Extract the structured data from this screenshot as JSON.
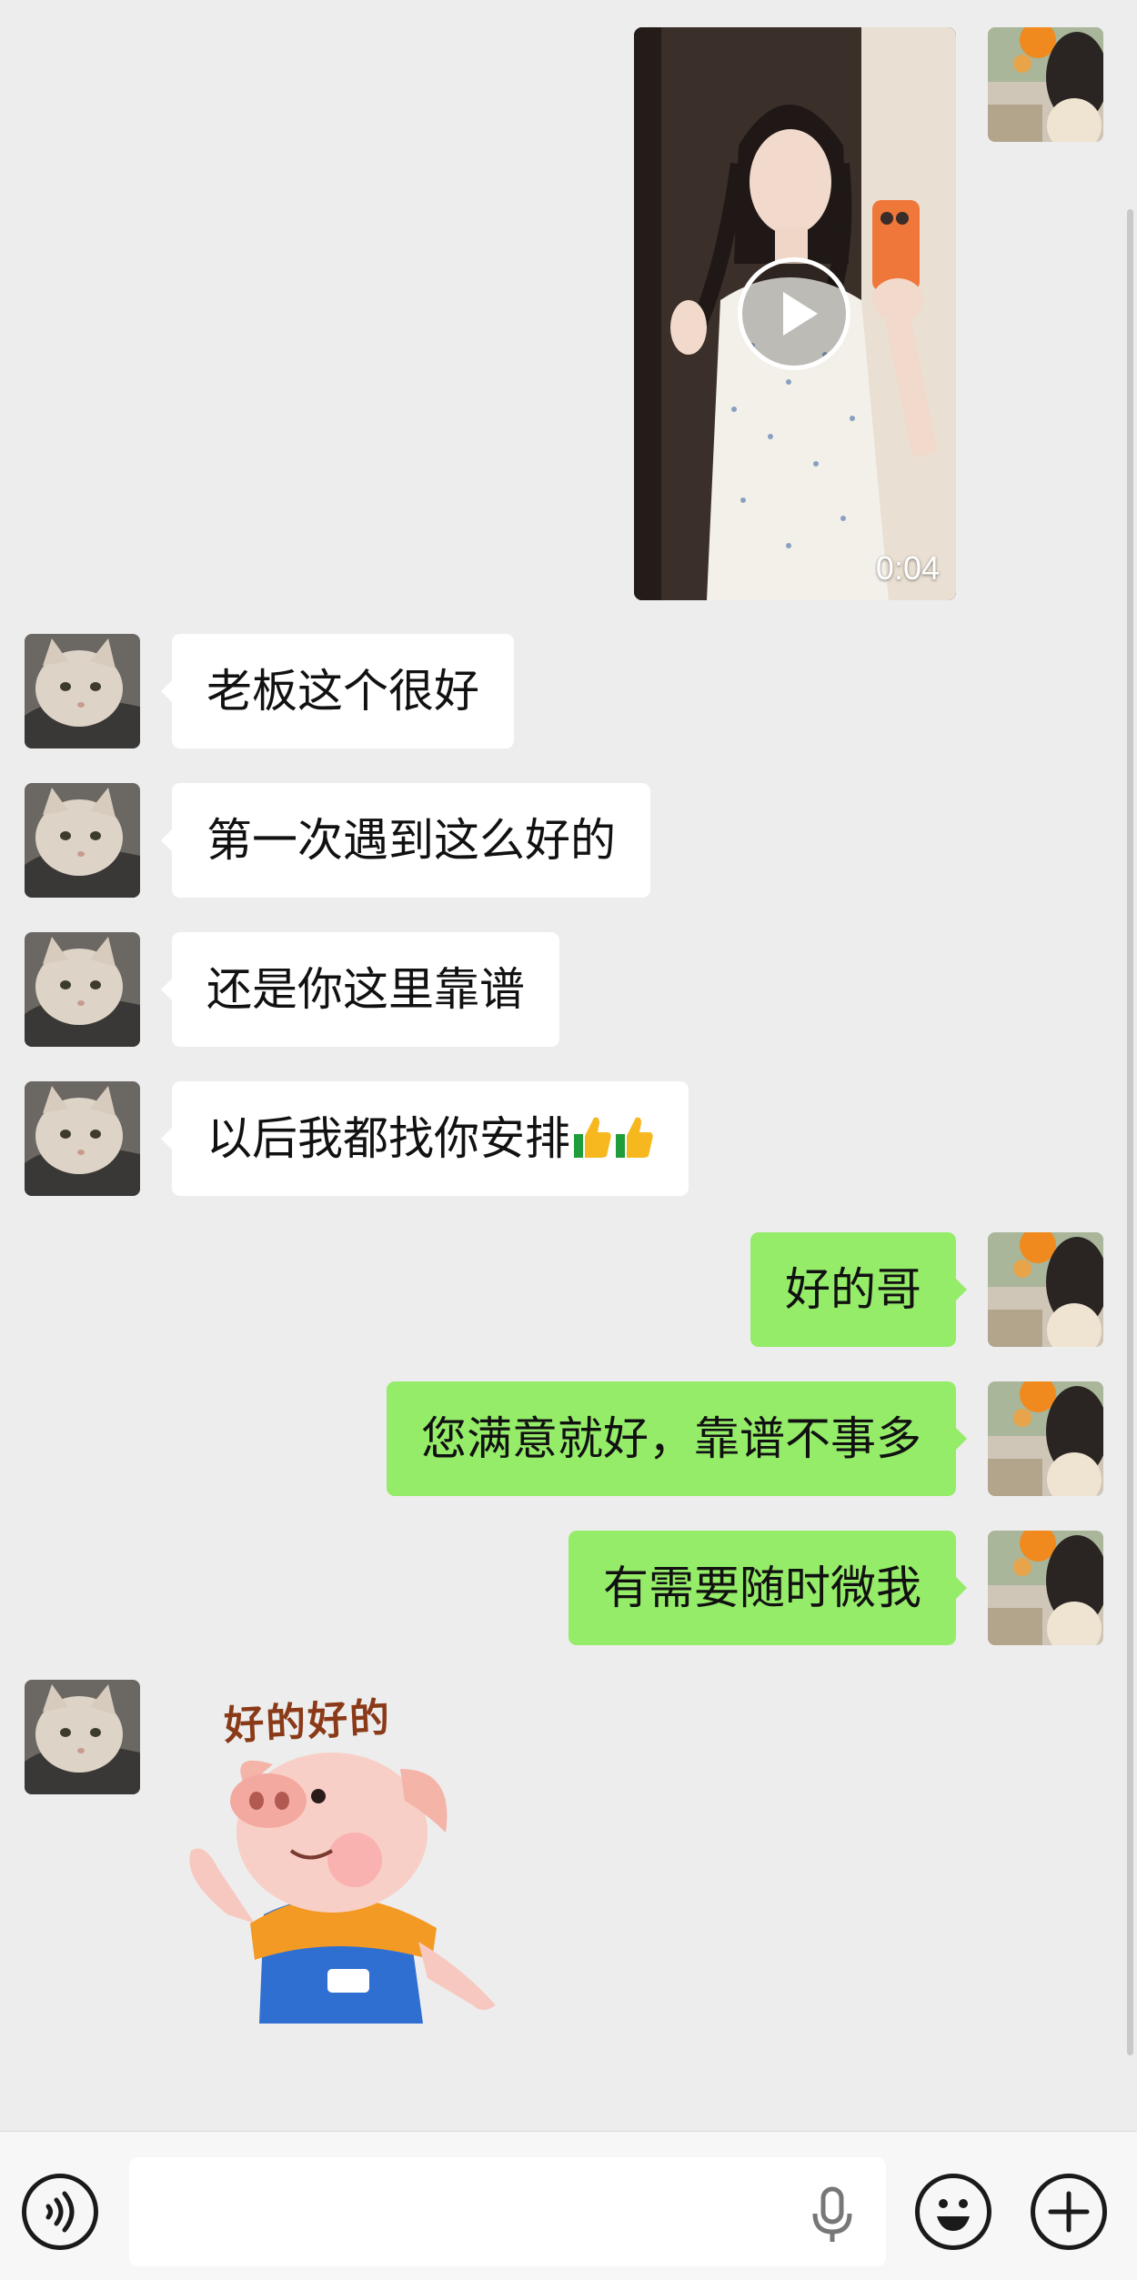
{
  "video_message": {
    "duration": "0:04"
  },
  "messages": [
    {
      "side": "in",
      "text": "老板这个很好"
    },
    {
      "side": "in",
      "text": "第一次遇到这么好的"
    },
    {
      "side": "in",
      "text": "还是你这里靠谱"
    },
    {
      "side": "in",
      "text": "以后我都找你安排"
    },
    {
      "side": "out",
      "text": "好的哥"
    },
    {
      "side": "out",
      "text": "您满意就好，靠谱不事多"
    },
    {
      "side": "out",
      "text": "有需要随时微我"
    }
  ],
  "sticker": {
    "text": "好的好的"
  },
  "input_bar": {
    "value": "",
    "placeholder": ""
  },
  "icons": {
    "voice": "voice-mode-icon",
    "mic": "microphone-icon",
    "emoji": "emoji-icon",
    "plus": "plus-icon",
    "thumbs": "thumbs-up-icon"
  },
  "colors": {
    "background": "#ededed",
    "incoming_bubble": "#ffffff",
    "outgoing_bubble": "#95ec69",
    "input_bar": "#f7f7f7"
  }
}
